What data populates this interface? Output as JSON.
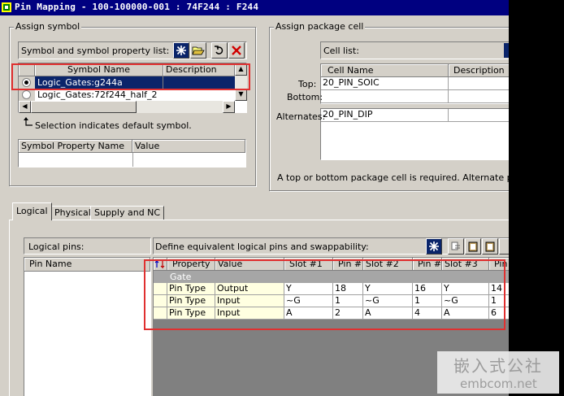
{
  "window": {
    "title": "Pin Mapping - 100-100000-001 : 74F244 : F244"
  },
  "assign_symbol": {
    "group_label": "Assign symbol",
    "list_label": "Symbol and symbol property list:",
    "columns": [
      "Symbol Name",
      "Description"
    ],
    "rows": [
      {
        "name": "Logic_Gates:g244a",
        "description": "",
        "selected": true
      },
      {
        "name": "Logic_Gates:72f244_half_2",
        "description": "",
        "selected": false
      }
    ],
    "hint": "Selection indicates default symbol.",
    "property_columns": [
      "Symbol Property Name",
      "Value"
    ]
  },
  "assign_package": {
    "group_label": "Assign package cell",
    "cell_list_label": "Cell list:",
    "columns": [
      "Cell Name",
      "Description"
    ],
    "top_label": "Top:",
    "top_value": "20_PIN_SOIC",
    "bottom_label": "Bottom:",
    "bottom_value": "",
    "alternates_label": "Alternates:",
    "alternates_value": "20_PIN_DIP",
    "note": "A top or bottom package cell is required.  Alternate package"
  },
  "tabs": [
    {
      "label": "Logical",
      "active": true
    },
    {
      "label": "Physical",
      "active": false
    },
    {
      "label": "Supply and NC",
      "active": false
    }
  ],
  "logical_pins": {
    "label": "Logical pins:",
    "column": "Pin Name"
  },
  "equivalent": {
    "label": "Define equivalent logical pins and swappability:",
    "columns": [
      "Property",
      "Value",
      "Slot #1",
      "Pin #",
      "Slot #2",
      "Pin #",
      "Slot #3",
      "Pin"
    ],
    "group_row": "Gate",
    "rows": [
      [
        "Pin Type",
        "Output",
        "Y",
        "18",
        "Y",
        "16",
        "Y",
        "14"
      ],
      [
        "Pin Type",
        "Input",
        "~G",
        "1",
        "~G",
        "1",
        "~G",
        "1"
      ],
      [
        "Pin Type",
        "Input",
        "A",
        "2",
        "A",
        "4",
        "A",
        "6"
      ]
    ]
  },
  "watermark": {
    "chinese": "嵌入式公社",
    "url": "embcom.net"
  },
  "colors": {
    "title_bar": "#000080",
    "selection": "#0a246a",
    "highlight_box": "#e03030",
    "face": "#d4d0c8",
    "yellow_cell": "#ffffe1"
  }
}
